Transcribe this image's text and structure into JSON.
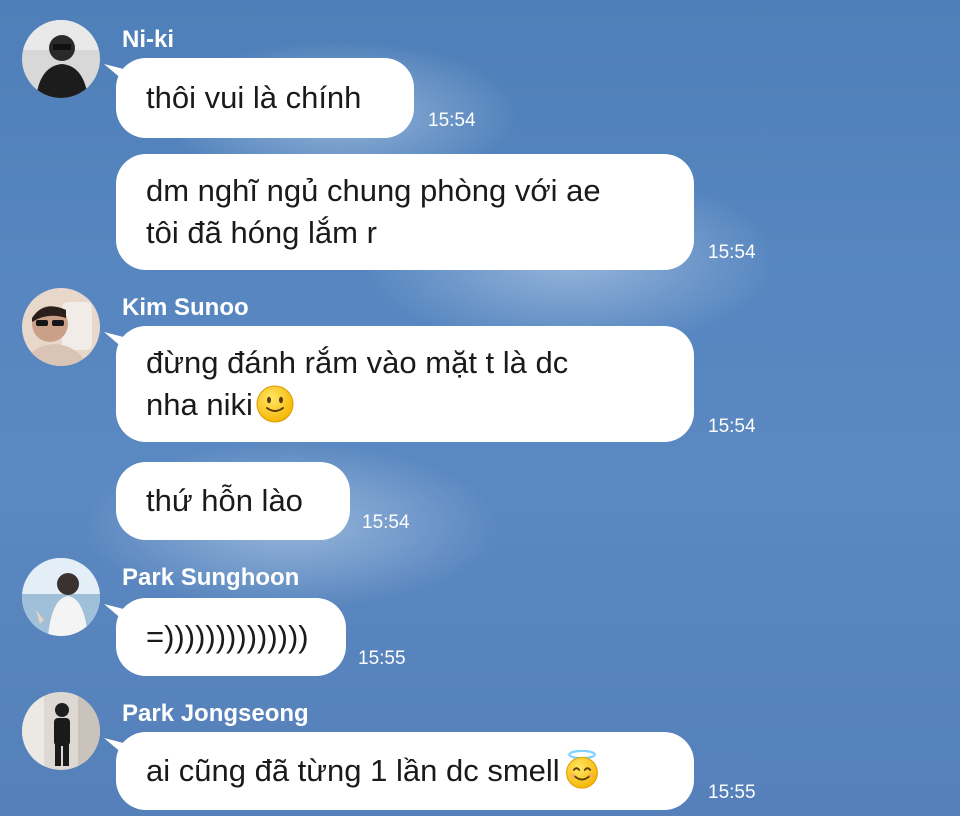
{
  "messages": [
    {
      "sender": "Ni-ki",
      "lines": [
        "thôi vui là chính"
      ],
      "time": "15:54"
    },
    {
      "sender": "",
      "lines": [
        "dm nghĩ ngủ chung phòng với ae",
        "tôi đã hóng lắm r"
      ],
      "time": "15:54"
    },
    {
      "sender": "Kim Sunoo",
      "lines": [
        "đừng đánh rắm vào mặt t là dc",
        "nha niki"
      ],
      "emoji": "slightly-smiling-face",
      "time": "15:54"
    },
    {
      "sender": "",
      "lines": [
        "thứ hỗn lào"
      ],
      "time": "15:54"
    },
    {
      "sender": "Park Sunghoon",
      "lines": [
        "=))))))))))))))"
      ],
      "time": "15:55"
    },
    {
      "sender": "Park Jongseong",
      "lines": [
        "ai cũng đã từng 1 lần dc smell"
      ],
      "emoji": "smiling-face-with-halo",
      "time": "15:55"
    }
  ],
  "colors": {
    "background": "#5786c0",
    "bubble": "#ffffff",
    "text": "#1a1a1a",
    "meta_text": "#ffffff"
  }
}
